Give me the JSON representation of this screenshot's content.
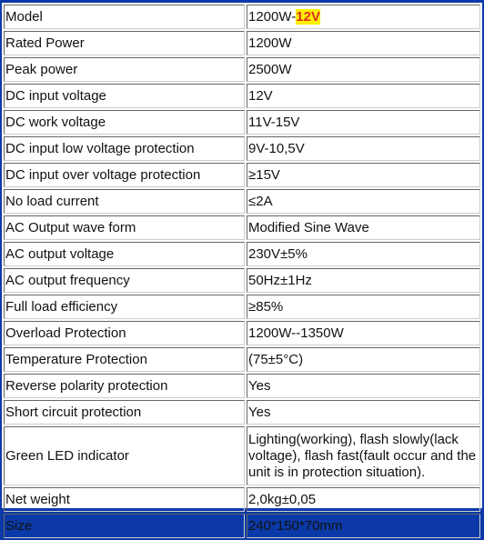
{
  "model": {
    "label": "Model",
    "value_prefix": "1200W-",
    "value_highlight": "12V",
    "highlight_bg": "#ffee00",
    "highlight_color": "#e0301e"
  },
  "rows": [
    {
      "label": "Rated Power",
      "value": "1200W"
    },
    {
      "label": "Peak power",
      "value": "2500W"
    },
    {
      "label": "DC input voltage",
      "value": "12V"
    },
    {
      "label": "DC work voltage",
      "value": "11V-15V"
    },
    {
      "label": "DC input low voltage protection",
      "value": "9V-10,5V"
    },
    {
      "label": "DC input over voltage protection",
      "value": "≥15V"
    },
    {
      "label": "No load current",
      "value": "≤2A"
    },
    {
      "label": "AC Output wave form",
      "value": "Modified Sine Wave"
    },
    {
      "label": "AC output voltage",
      "value": "230V±5%"
    },
    {
      "label": "AC output frequency",
      "value": "50Hz±1Hz"
    },
    {
      "label": "Full load efficiency",
      "value": "≥85%"
    },
    {
      "label": "Overload Protection",
      "value": "1200W--1350W"
    },
    {
      "label": "Temperature Protection",
      "value": "(75±5°C)"
    },
    {
      "label": "Reverse polarity protection",
      "value": "Yes"
    },
    {
      "label": "Short circuit protection",
      "value": "Yes"
    },
    {
      "label": "Green LED indicator",
      "value": "Lighting(working), flash slowly(lack voltage), flash fast(fault occur and the unit is in protection situation).",
      "tall": true
    },
    {
      "label": "Net weight",
      "value": "2,0kg±0,05"
    },
    {
      "label": "Size",
      "value": "240*150*70mm"
    }
  ]
}
